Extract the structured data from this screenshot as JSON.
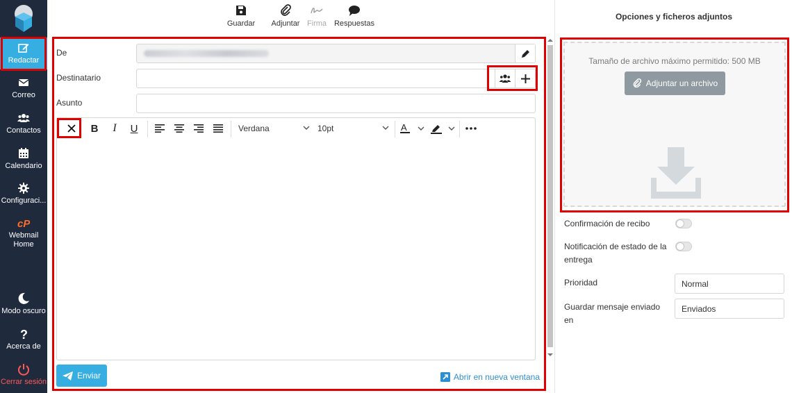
{
  "sidebar": {
    "items": [
      {
        "label": "Redactar",
        "icon": "compose-icon"
      },
      {
        "label": "Correo",
        "icon": "envelope-icon"
      },
      {
        "label": "Contactos",
        "icon": "contacts-icon"
      },
      {
        "label": "Calendario",
        "icon": "calendar-icon"
      },
      {
        "label": "Configuraci...",
        "icon": "gear-icon"
      },
      {
        "label": "Webmail Home",
        "icon": "cpanel-icon"
      },
      {
        "label": "Modo oscuro",
        "icon": "moon-icon"
      },
      {
        "label": "Acerca de",
        "icon": "question-icon"
      },
      {
        "label": "Cerrar sesión",
        "icon": "power-icon"
      }
    ]
  },
  "toolbar": {
    "save": "Guardar",
    "attach": "Adjuntar",
    "signature": "Firma",
    "responses": "Respuestas"
  },
  "compose": {
    "from_label": "De",
    "to_label": "Destinatario",
    "subject_label": "Asunto",
    "subject_value": "",
    "font": "Verdana",
    "font_size": "10pt",
    "send": "Enviar",
    "open_new_window": "Abrir en nueva ventana"
  },
  "right_panel": {
    "title": "Opciones y ficheros adjuntos",
    "max_size": "Tamaño de archivo máximo permitido: 500 MB",
    "attach_button": "Adjuntar un archivo",
    "read_receipt": "Confirmación de recibo",
    "delivery_status": "Notificación de estado de la entrega",
    "priority_label": "Prioridad",
    "priority_value": "Normal",
    "save_sent_label": "Guardar mensaje enviado en",
    "save_sent_value": "Enviados"
  },
  "colors": {
    "sidebar_bg": "#1f2a3d",
    "accent": "#37aee2",
    "highlight": "#e00000",
    "logout": "#ff5a5a"
  }
}
